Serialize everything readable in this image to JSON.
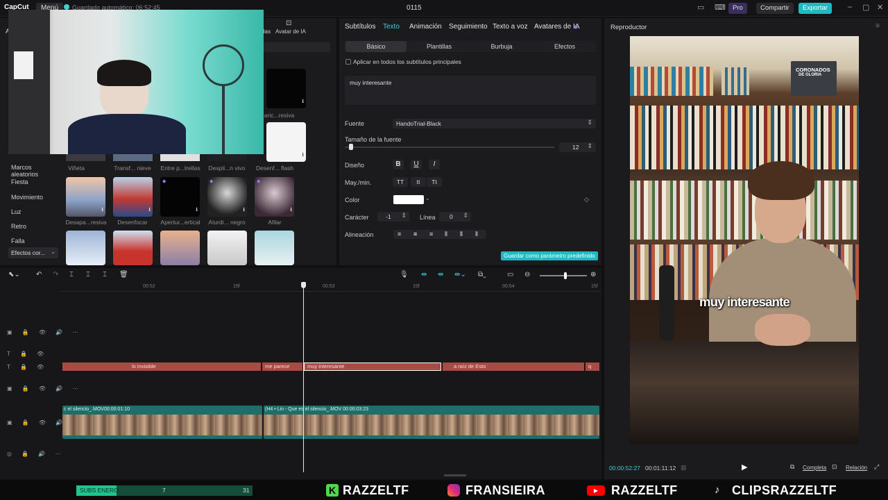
{
  "titlebar": {
    "logo": "CapCut",
    "menu": "Menú",
    "autosave": "Guardado automático: 06:52:45",
    "project": "0115",
    "pro": "Pro",
    "share": "Compartir",
    "export": "Exportar"
  },
  "media": {
    "tabs": [
      "llas",
      "Avatar de IA"
    ],
    "categories": [
      "Marcos aleatorios",
      "Fiesta",
      "Movimiento",
      "Luz",
      "Retro",
      "Falla",
      "Efectos cor..."
    ],
    "row0": [
      "Viñeta",
      "Transf... nieve",
      "Entre p...trellas",
      "Despli...n vivo",
      "Desenf... flash"
    ],
    "row0b_right": "...aric...resiva",
    "row1": [
      "Desapa...resiva",
      "Desenfocar",
      "Apertur...ertical",
      "Aturdi... negro",
      "Afilar"
    ]
  },
  "props": {
    "tabs": [
      "Subtítulos",
      "Texto",
      "Animación",
      "Seguimiento",
      "Texto a voz",
      "Avatares de IA"
    ],
    "subtabs": [
      "Básico",
      "Plantillas",
      "Burbuja",
      "Efectos"
    ],
    "apply_all": "Aplicar en todos los subtítulos principales",
    "text_value": "muy interesante",
    "font_label": "Fuente",
    "font_value": "HandoTrial-Black",
    "size_label": "Tamaño de la fuente",
    "size_value": "12",
    "design_label": "Diseño",
    "case_label": "May./min.",
    "case_options": [
      "TT",
      "tt",
      "Tt"
    ],
    "color_label": "Color",
    "color_value": "#ffffff",
    "char_label": "Carácter",
    "char_value": "-1",
    "line_label": "Línea",
    "line_value": "0",
    "align_label": "Alineación",
    "save_preset": "Guardar como parámetro predefinido"
  },
  "timeline": {
    "ruler": [
      "00:52",
      "15f",
      "00:53",
      "15f",
      "00:54",
      "15f"
    ],
    "text_clips": [
      {
        "label": "lo invisible"
      },
      {
        "label": "me parece"
      },
      {
        "label": "muy interesante"
      },
      {
        "label": "a raíz de Esto"
      },
      {
        "label": "q"
      }
    ],
    "video_clips": [
      {
        "label": "c el silencio_.MOV",
        "duration": "00:00:01:10"
      },
      {
        "label": "(H4 • Lin - Que es el silencio_.MOV",
        "duration": "00:00:03:23"
      }
    ]
  },
  "player": {
    "title": "Reproductor",
    "caption": "muy interesante",
    "book_title_1": "CORONADOS",
    "book_title_2": "DE GLORIA",
    "current_time": "00:00:52:27",
    "total_time": "00:01:11:12",
    "complete": "Completa",
    "ratio": "Relación"
  },
  "footer": {
    "subs_label": "SUBS ENERO",
    "subs_current": "7",
    "subs_goal": "31",
    "subs_progress": 0.23,
    "handles": [
      "RAZZELTF",
      "FRANSIEIRA",
      "RAZZELTF",
      "CLIPSRAZZELTF"
    ]
  },
  "colors": {
    "accent": "#3fd0d6",
    "text_clip": "#a84b44",
    "video_clip": "#1e6e6b",
    "export": "#1fb9c4",
    "subs_bar": "#1fc58e"
  }
}
